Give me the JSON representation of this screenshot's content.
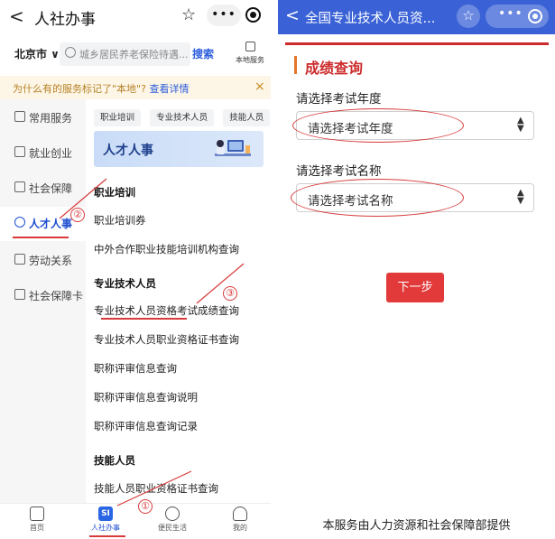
{
  "left": {
    "header": {
      "back": "<",
      "title": "人社办事",
      "star": "☆",
      "dots": "•••",
      "target": "⊙"
    },
    "search": {
      "city": "北京市 ∨",
      "placeholder": "城乡居民养老保险待遇...",
      "button": "搜索",
      "local_label": "本地服务"
    },
    "notice": {
      "text": "为什么有的服务标记了\"本地\"?",
      "link": "查看详情",
      "close": "×"
    },
    "sidebar": [
      {
        "label": "常用服务"
      },
      {
        "label": "就业创业"
      },
      {
        "label": "社会保障"
      },
      {
        "label": "人才人事"
      },
      {
        "label": "劳动关系"
      },
      {
        "label": "社会保障卡"
      }
    ],
    "tags": [
      "职业培训",
      "专业技术人员",
      "技能人员"
    ],
    "banner": {
      "text": "人才人事"
    },
    "sections": [
      {
        "title": "职业培训",
        "links": [
          "职业培训券",
          "中外合作职业技能培训机构查询"
        ]
      },
      {
        "title": "专业技术人员",
        "links": [
          "专业技术人员资格考试成绩查询",
          "专业技术人员职业资格证书查询",
          "职称评审信息查询",
          "职称评审信息查询说明",
          "职称评审信息查询记录"
        ]
      },
      {
        "title": "技能人员",
        "links": [
          "技能人员职业资格证书查询"
        ]
      }
    ],
    "tabbar": [
      {
        "label": "首页",
        "icon": "home-icon"
      },
      {
        "label": "人社办事",
        "icon": "si-icon",
        "glyph": "SI"
      },
      {
        "label": "便民生活",
        "icon": "heart-icon"
      },
      {
        "label": "我的",
        "icon": "person-icon"
      }
    ],
    "annotations": [
      "①",
      "②",
      "③"
    ]
  },
  "right": {
    "header": {
      "back": "<",
      "title": "全国专业技术人员资...",
      "star": "☆",
      "dots": "•••"
    },
    "heading": "成绩查询",
    "year": {
      "label": "请选择考试年度",
      "value": "请选择考试年度"
    },
    "exam": {
      "label": "请选择考试名称",
      "value": "请选择考试名称"
    },
    "next_button": "下一步",
    "footer": "本服务由人力资源和社会保障部提供"
  }
}
